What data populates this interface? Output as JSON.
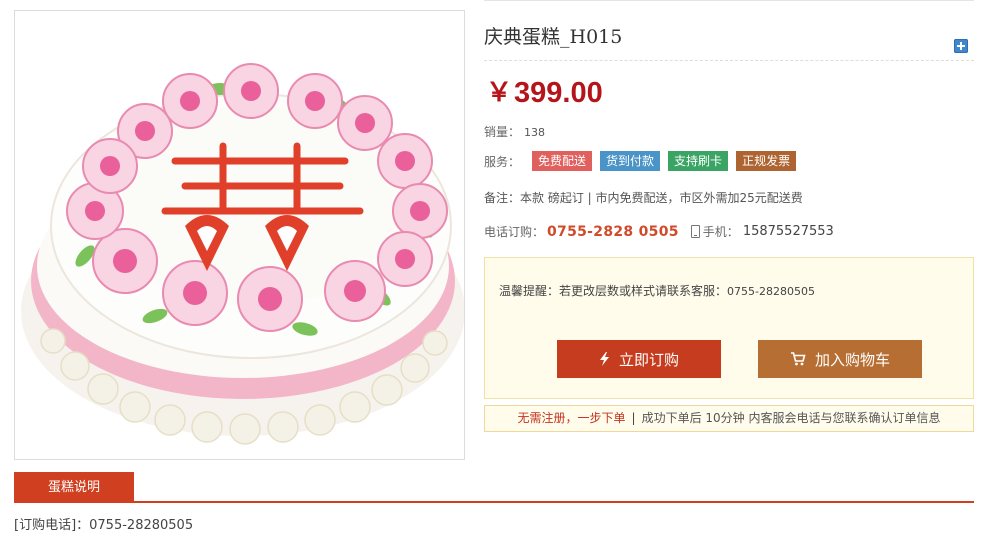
{
  "product": {
    "title": "庆典蛋糕_H015",
    "currency": "￥",
    "price": "399.00",
    "sales_label": "销量：",
    "sales_value": "138",
    "services_label": "服务：",
    "services": [
      {
        "label": "免费配送",
        "color": "#e0605d"
      },
      {
        "label": "货到付款",
        "color": "#4a94c7"
      },
      {
        "label": "支持刷卡",
        "color": "#3aa464"
      },
      {
        "label": "正规发票",
        "color": "#ad6430"
      }
    ],
    "note": "备注：本款 磅起订 | 市内免费配送，市区外需加25元配送费",
    "phone_label": "电话订购：",
    "hotline": "0755-2828 0505",
    "mobile_label": "手机：",
    "mobile": "15875527553"
  },
  "tip": {
    "text": "温馨提醒：若更改层数或样式请联系客服：",
    "phone": "0755-28280505"
  },
  "buttons": {
    "buy": "立即订购",
    "cart": "加入购物车"
  },
  "flow": {
    "emphasis": "无需注册，一步下单",
    "separator": "|",
    "rest": "成功下单后 10分钟 内客服会电话与您联系确认订单信息"
  },
  "tabs": [
    {
      "label": "蛋糕说明"
    }
  ],
  "details": {
    "order_phone": "[订购电话]：0755-28280505"
  },
  "colors": {
    "price": "#b5141a",
    "accent": "#cf3f20",
    "buy_button": "#c63c1e",
    "cart_button": "#b66e32"
  },
  "icons": [
    "plus-icon",
    "lightning-icon",
    "cart-icon",
    "mobile-phone-icon"
  ]
}
